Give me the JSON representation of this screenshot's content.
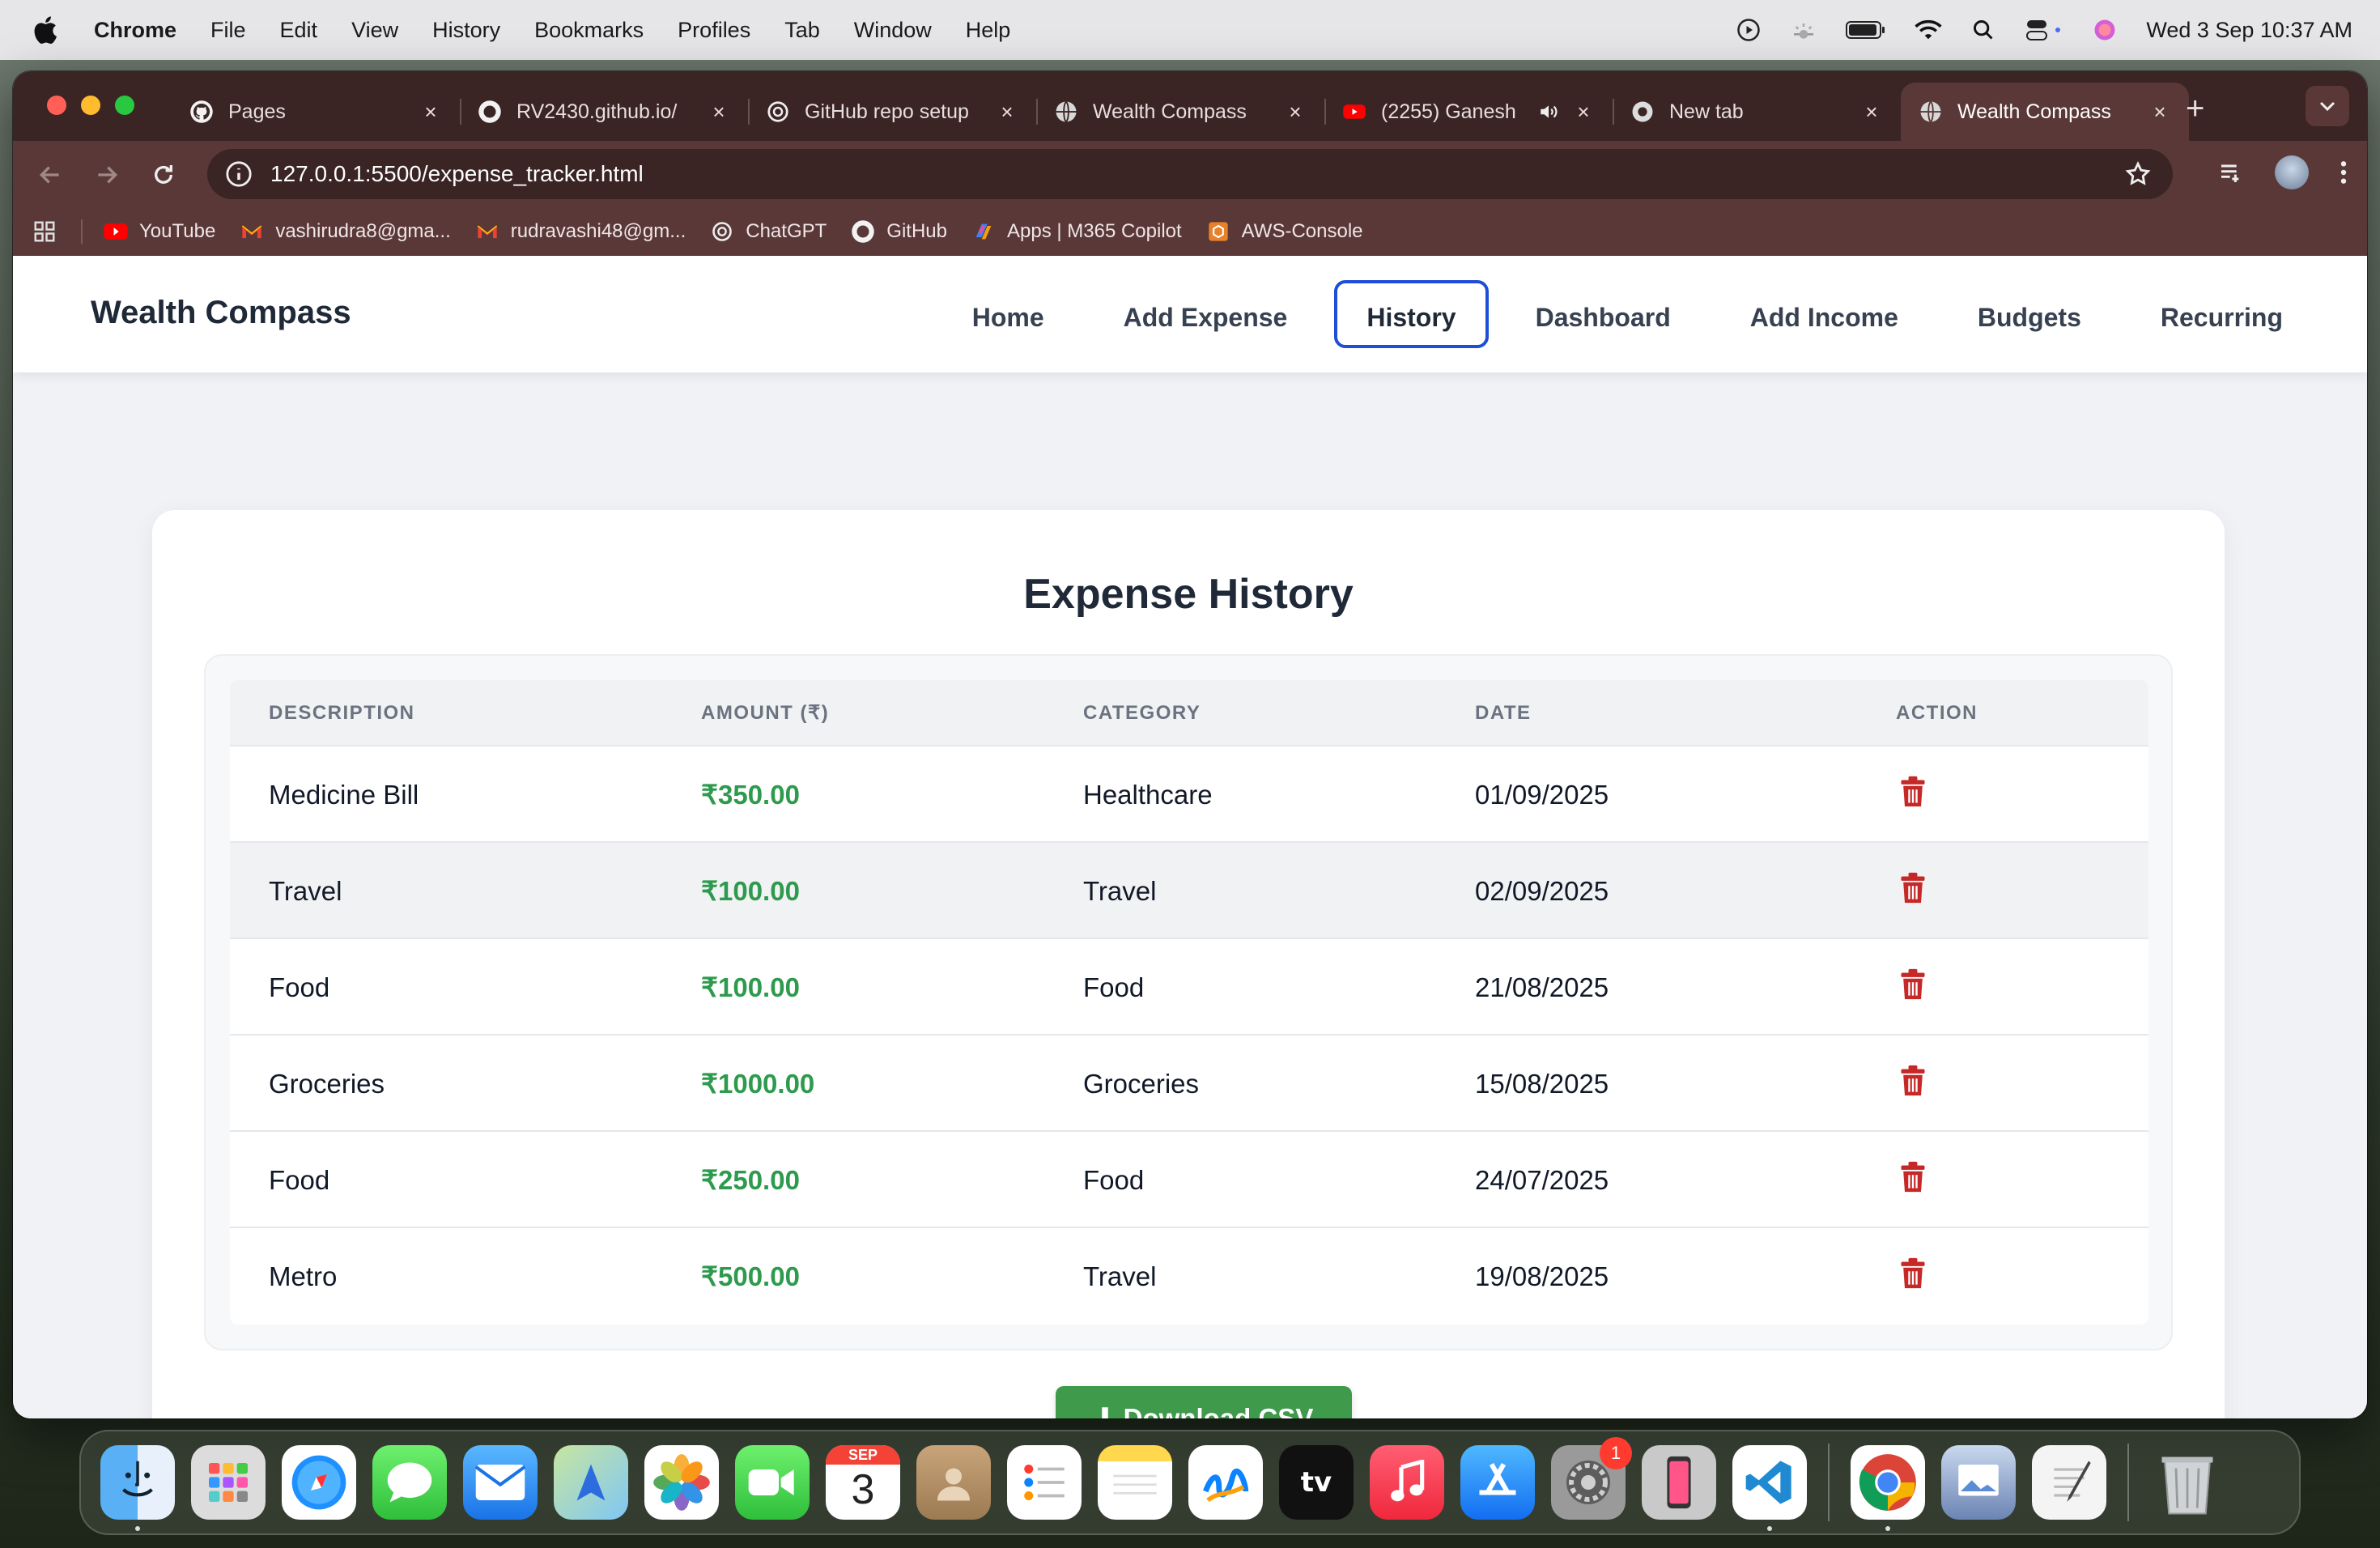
{
  "menubar": {
    "app_name": "Chrome",
    "items": [
      "File",
      "Edit",
      "View",
      "History",
      "Bookmarks",
      "Profiles",
      "Tab",
      "Window",
      "Help"
    ],
    "clock": "Wed 3 Sep  10:37 AM"
  },
  "browser": {
    "tabs": [
      {
        "label": "Pages",
        "icon": "github-icon"
      },
      {
        "label": "RV2430.github.io/",
        "icon": "github-icon"
      },
      {
        "label": "GitHub repo setup",
        "icon": "chatgpt-icon"
      },
      {
        "label": "Wealth Compass",
        "icon": "globe-icon"
      },
      {
        "label": "(2255) Ganesh",
        "icon": "youtube-icon"
      },
      {
        "label": "New tab",
        "icon": "chrome-icon"
      },
      {
        "label": "Wealth Compass",
        "icon": "globe-icon",
        "active": true
      }
    ],
    "url": "127.0.0.1:5500/expense_tracker.html",
    "bookmarks": [
      {
        "label": "YouTube",
        "icon": "youtube-icon"
      },
      {
        "label": "vashirudra8@gma...",
        "icon": "gmail-icon"
      },
      {
        "label": "rudravashi48@gm...",
        "icon": "gmail-icon"
      },
      {
        "label": "ChatGPT",
        "icon": "chatgpt-icon"
      },
      {
        "label": "GitHub",
        "icon": "github-icon"
      },
      {
        "label": "Apps | M365 Copilot",
        "icon": "copilot-icon"
      },
      {
        "label": "AWS-Console",
        "icon": "aws-icon"
      }
    ]
  },
  "site": {
    "brand": "Wealth Compass",
    "nav": [
      "Home",
      "Add Expense",
      "History",
      "Dashboard",
      "Add Income",
      "Budgets",
      "Recurring"
    ],
    "active_nav": "History"
  },
  "history": {
    "title": "Expense History",
    "columns": [
      "DESCRIPTION",
      "AMOUNT (₹)",
      "CATEGORY",
      "DATE",
      "ACTION"
    ],
    "rows": [
      {
        "description": "Medicine Bill",
        "amount": "₹350.00",
        "category": "Healthcare",
        "date": "01/09/2025"
      },
      {
        "description": "Travel",
        "amount": "₹100.00",
        "category": "Travel",
        "date": "02/09/2025"
      },
      {
        "description": "Food",
        "amount": "₹100.00",
        "category": "Food",
        "date": "21/08/2025"
      },
      {
        "description": "Groceries",
        "amount": "₹1000.00",
        "category": "Groceries",
        "date": "15/08/2025"
      },
      {
        "description": "Food",
        "amount": "₹250.00",
        "category": "Food",
        "date": "24/07/2025"
      },
      {
        "description": "Metro",
        "amount": "₹500.00",
        "category": "Travel",
        "date": "19/08/2025"
      }
    ],
    "download_label": "Download CSV"
  },
  "dock": {
    "calendar_month": "SEP",
    "calendar_day": "3",
    "settings_badge": "1"
  },
  "colors": {
    "amount": "#2e9a4e",
    "delete": "#c62828",
    "accent": "#1d4ed8",
    "download": "#3f9a4c"
  }
}
